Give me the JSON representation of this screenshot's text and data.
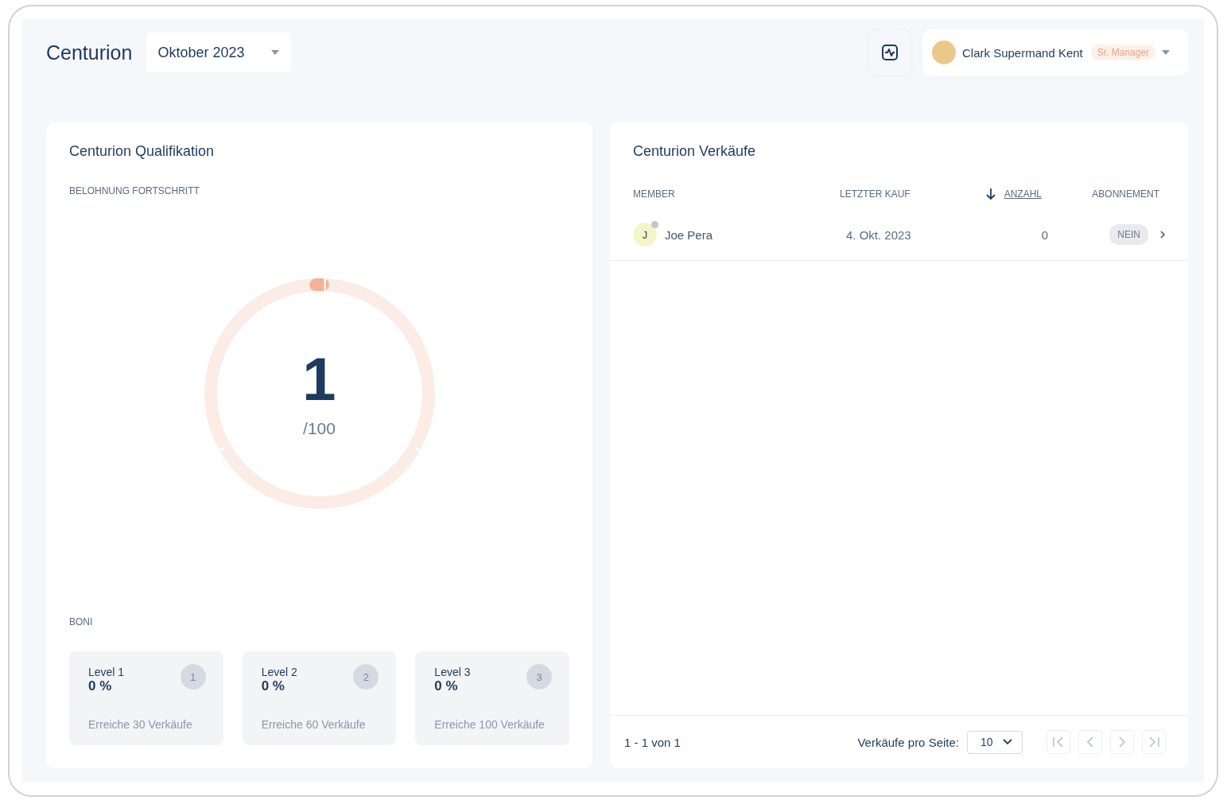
{
  "header": {
    "title": "Centurion",
    "month": "Oktober 2023",
    "user": {
      "name": "Clark Supermand Kent",
      "role": "Sr. Manager"
    }
  },
  "qualification": {
    "title": "Centurion Qualifikation",
    "progress_label": "BELOHNUNG FORTSCHRITT",
    "value": "1",
    "total": "/100",
    "level": 0.01,
    "bonus_label": "BONI",
    "levels": [
      {
        "title": "Level 1",
        "percent": "0 %",
        "badge": "1",
        "hint": "Erreiche 30 Verkäufe"
      },
      {
        "title": "Level 2",
        "percent": "0 %",
        "badge": "2",
        "hint": "Erreiche 60 Verkäufe"
      },
      {
        "title": "Level 3",
        "percent": "0 %",
        "badge": "3",
        "hint": "Erreiche 100 Verkäufe"
      }
    ]
  },
  "sales": {
    "title": "Centurion Verkäufe",
    "columns": [
      {
        "label": "MEMBER",
        "sorted": false
      },
      {
        "label": "LETZTER KAUF",
        "sorted": false
      },
      {
        "label": "ANZAHL",
        "sorted": true
      },
      {
        "label": "ABONNEMENT",
        "sorted": false
      }
    ],
    "rows": [
      {
        "initial": "J",
        "name": "Joe Pera",
        "online": false,
        "last_purchase": "4. Okt. 2023",
        "count": "0",
        "subscription": "NEIN"
      }
    ],
    "range": "1 - 1 von 1",
    "per_page_label": "Verkäufe pro Seite:",
    "per_page": "10"
  }
}
